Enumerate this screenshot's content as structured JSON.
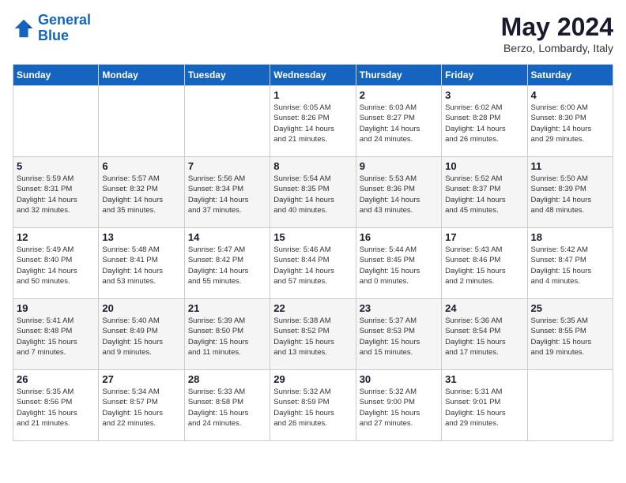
{
  "header": {
    "logo_line1": "General",
    "logo_line2": "Blue",
    "month": "May 2024",
    "location": "Berzo, Lombardy, Italy"
  },
  "weekdays": [
    "Sunday",
    "Monday",
    "Tuesday",
    "Wednesday",
    "Thursday",
    "Friday",
    "Saturday"
  ],
  "weeks": [
    [
      {
        "day": "",
        "info": ""
      },
      {
        "day": "",
        "info": ""
      },
      {
        "day": "",
        "info": ""
      },
      {
        "day": "1",
        "info": "Sunrise: 6:05 AM\nSunset: 8:26 PM\nDaylight: 14 hours\nand 21 minutes."
      },
      {
        "day": "2",
        "info": "Sunrise: 6:03 AM\nSunset: 8:27 PM\nDaylight: 14 hours\nand 24 minutes."
      },
      {
        "day": "3",
        "info": "Sunrise: 6:02 AM\nSunset: 8:28 PM\nDaylight: 14 hours\nand 26 minutes."
      },
      {
        "day": "4",
        "info": "Sunrise: 6:00 AM\nSunset: 8:30 PM\nDaylight: 14 hours\nand 29 minutes."
      }
    ],
    [
      {
        "day": "5",
        "info": "Sunrise: 5:59 AM\nSunset: 8:31 PM\nDaylight: 14 hours\nand 32 minutes."
      },
      {
        "day": "6",
        "info": "Sunrise: 5:57 AM\nSunset: 8:32 PM\nDaylight: 14 hours\nand 35 minutes."
      },
      {
        "day": "7",
        "info": "Sunrise: 5:56 AM\nSunset: 8:34 PM\nDaylight: 14 hours\nand 37 minutes."
      },
      {
        "day": "8",
        "info": "Sunrise: 5:54 AM\nSunset: 8:35 PM\nDaylight: 14 hours\nand 40 minutes."
      },
      {
        "day": "9",
        "info": "Sunrise: 5:53 AM\nSunset: 8:36 PM\nDaylight: 14 hours\nand 43 minutes."
      },
      {
        "day": "10",
        "info": "Sunrise: 5:52 AM\nSunset: 8:37 PM\nDaylight: 14 hours\nand 45 minutes."
      },
      {
        "day": "11",
        "info": "Sunrise: 5:50 AM\nSunset: 8:39 PM\nDaylight: 14 hours\nand 48 minutes."
      }
    ],
    [
      {
        "day": "12",
        "info": "Sunrise: 5:49 AM\nSunset: 8:40 PM\nDaylight: 14 hours\nand 50 minutes."
      },
      {
        "day": "13",
        "info": "Sunrise: 5:48 AM\nSunset: 8:41 PM\nDaylight: 14 hours\nand 53 minutes."
      },
      {
        "day": "14",
        "info": "Sunrise: 5:47 AM\nSunset: 8:42 PM\nDaylight: 14 hours\nand 55 minutes."
      },
      {
        "day": "15",
        "info": "Sunrise: 5:46 AM\nSunset: 8:44 PM\nDaylight: 14 hours\nand 57 minutes."
      },
      {
        "day": "16",
        "info": "Sunrise: 5:44 AM\nSunset: 8:45 PM\nDaylight: 15 hours\nand 0 minutes."
      },
      {
        "day": "17",
        "info": "Sunrise: 5:43 AM\nSunset: 8:46 PM\nDaylight: 15 hours\nand 2 minutes."
      },
      {
        "day": "18",
        "info": "Sunrise: 5:42 AM\nSunset: 8:47 PM\nDaylight: 15 hours\nand 4 minutes."
      }
    ],
    [
      {
        "day": "19",
        "info": "Sunrise: 5:41 AM\nSunset: 8:48 PM\nDaylight: 15 hours\nand 7 minutes."
      },
      {
        "day": "20",
        "info": "Sunrise: 5:40 AM\nSunset: 8:49 PM\nDaylight: 15 hours\nand 9 minutes."
      },
      {
        "day": "21",
        "info": "Sunrise: 5:39 AM\nSunset: 8:50 PM\nDaylight: 15 hours\nand 11 minutes."
      },
      {
        "day": "22",
        "info": "Sunrise: 5:38 AM\nSunset: 8:52 PM\nDaylight: 15 hours\nand 13 minutes."
      },
      {
        "day": "23",
        "info": "Sunrise: 5:37 AM\nSunset: 8:53 PM\nDaylight: 15 hours\nand 15 minutes."
      },
      {
        "day": "24",
        "info": "Sunrise: 5:36 AM\nSunset: 8:54 PM\nDaylight: 15 hours\nand 17 minutes."
      },
      {
        "day": "25",
        "info": "Sunrise: 5:35 AM\nSunset: 8:55 PM\nDaylight: 15 hours\nand 19 minutes."
      }
    ],
    [
      {
        "day": "26",
        "info": "Sunrise: 5:35 AM\nSunset: 8:56 PM\nDaylight: 15 hours\nand 21 minutes."
      },
      {
        "day": "27",
        "info": "Sunrise: 5:34 AM\nSunset: 8:57 PM\nDaylight: 15 hours\nand 22 minutes."
      },
      {
        "day": "28",
        "info": "Sunrise: 5:33 AM\nSunset: 8:58 PM\nDaylight: 15 hours\nand 24 minutes."
      },
      {
        "day": "29",
        "info": "Sunrise: 5:32 AM\nSunset: 8:59 PM\nDaylight: 15 hours\nand 26 minutes."
      },
      {
        "day": "30",
        "info": "Sunrise: 5:32 AM\nSunset: 9:00 PM\nDaylight: 15 hours\nand 27 minutes."
      },
      {
        "day": "31",
        "info": "Sunrise: 5:31 AM\nSunset: 9:01 PM\nDaylight: 15 hours\nand 29 minutes."
      },
      {
        "day": "",
        "info": ""
      }
    ]
  ]
}
